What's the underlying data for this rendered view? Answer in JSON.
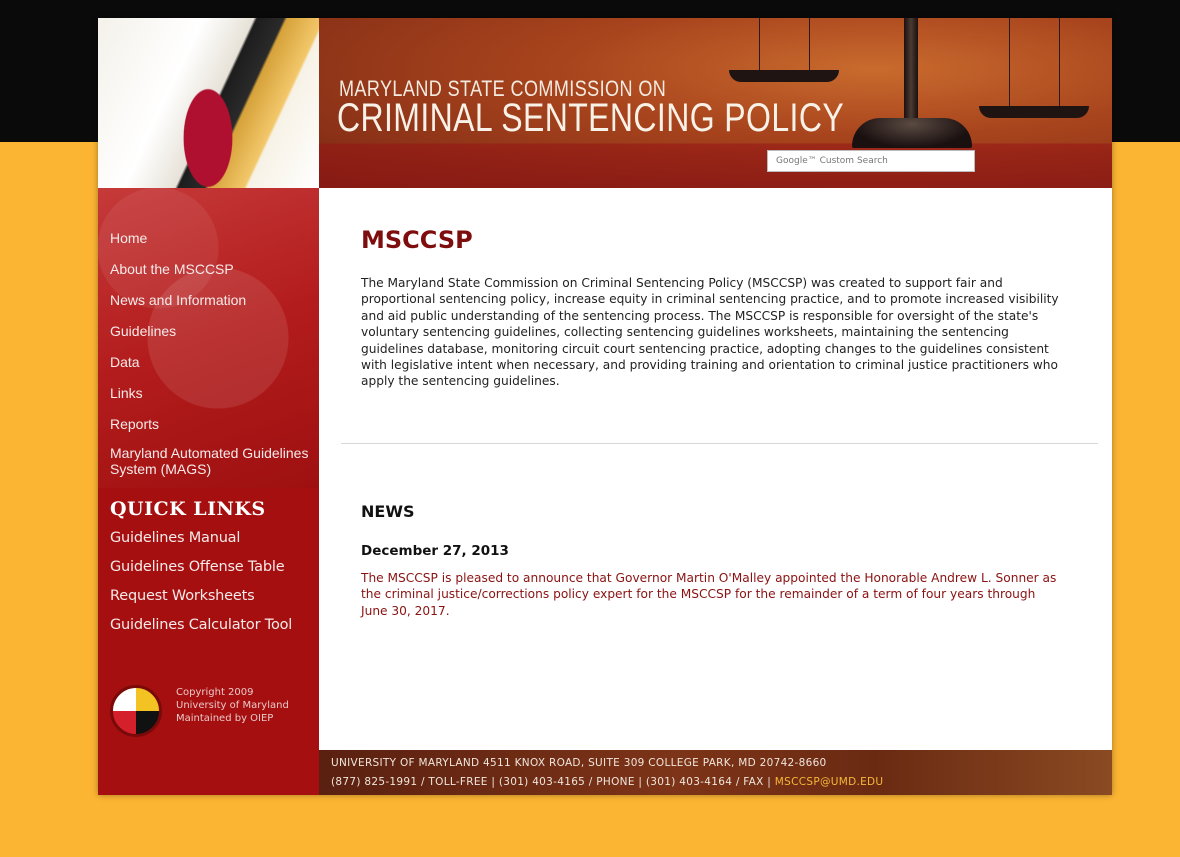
{
  "header": {
    "subtitle": "MARYLAND STATE COMMISSION ON",
    "title": "CRIMINAL SENTENCING POLICY",
    "search_placeholder": "Google™ Custom Search"
  },
  "sidebar": {
    "nav": [
      "Home",
      "About the MSCCSP",
      "News and Information",
      "Guidelines",
      "Data",
      "Links",
      "Reports",
      "Maryland Automated Guidelines System (MAGS)"
    ],
    "quick_links_title": "QUICK LINKS",
    "quick_links": [
      "Guidelines Manual",
      "Guidelines Offense Table",
      "Request Worksheets",
      "Guidelines Calculator Tool"
    ],
    "copyright": [
      "Copyright 2009",
      "University of Maryland",
      "Maintained by OIEP"
    ]
  },
  "main": {
    "title": "MSCCSP",
    "intro": "The Maryland State Commission on Criminal Sentencing Policy (MSCCSP) was created to support fair and proportional sentencing policy, increase equity in criminal sentencing practice, and to promote increased visibility and aid public understanding of the sentencing process. The MSCCSP is responsible for oversight of the state's voluntary sentencing guidelines, collecting sentencing guidelines worksheets, maintaining the sentencing guidelines database, monitoring circuit court sentencing practice, adopting changes to the guidelines consistent with legislative intent when necessary, and providing training and orientation to criminal justice practitioners who apply the sentencing guidelines.",
    "news_heading": "NEWS",
    "news": [
      {
        "date": "December 27, 2013",
        "body": "The MSCCSP is pleased to announce that Governor Martin O'Malley appointed the Honorable Andrew L. Sonner as the criminal justice/corrections policy expert for the MSCCSP for the remainder of a term of four years through June 30, 2017."
      }
    ]
  },
  "footer": {
    "line1": "UNIVERSITY OF MARYLAND 4511 KNOX ROAD, SUITE 309 COLLEGE PARK, MD 20742-8660",
    "line2": "(877) 825-1991 / TOLL-FREE | (301) 403-4165 / PHONE | (301) 403-4164 / FAX | ",
    "email": "MSCCSP@UMD.EDU"
  },
  "colors": {
    "page_background": "#fbb533",
    "sidebar_red": "#a50f0f",
    "title_red": "#7e0d0d",
    "news_text": "#8a1212",
    "footer_email": "#f5b83a"
  }
}
